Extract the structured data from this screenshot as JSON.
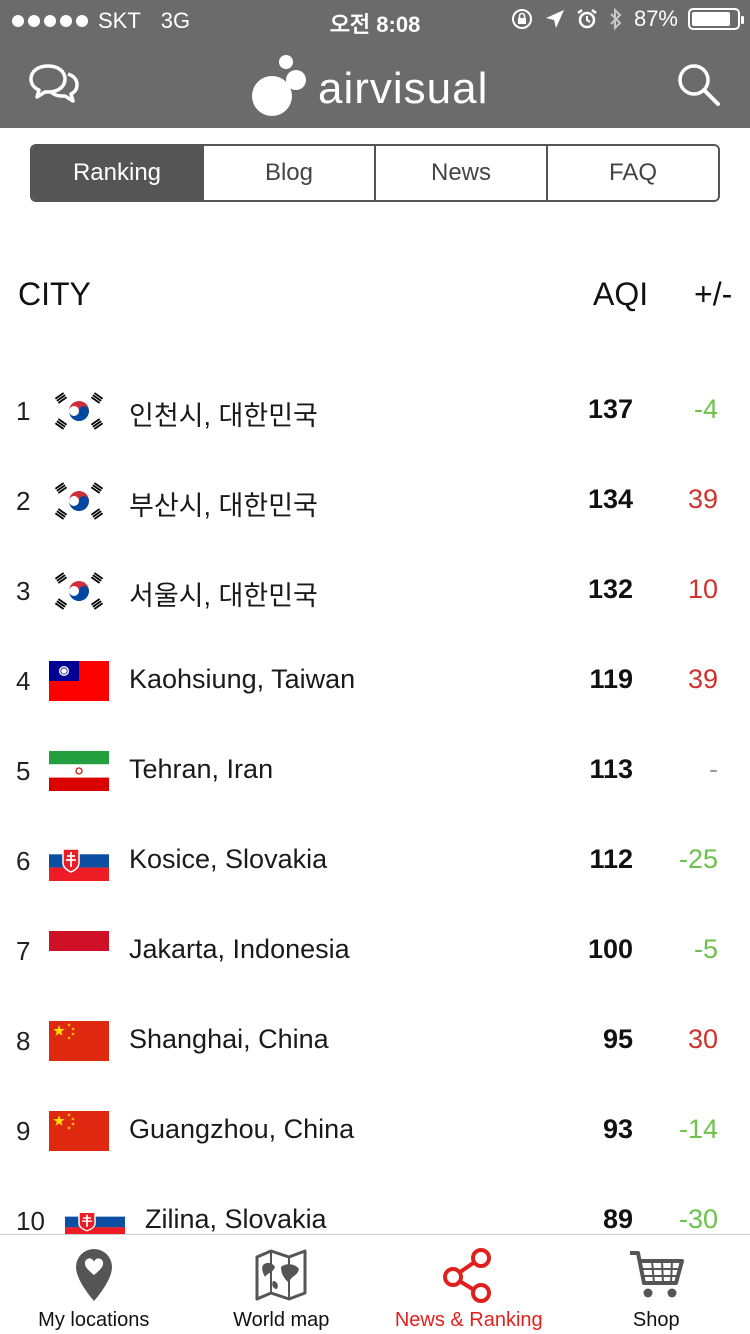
{
  "status_bar": {
    "carrier": "SKT",
    "network": "3G",
    "time": "오전 8:08",
    "battery": "87%"
  },
  "app": {
    "name": "airvisual"
  },
  "tabs": [
    {
      "label": "Ranking",
      "active": true
    },
    {
      "label": "Blog",
      "active": false
    },
    {
      "label": "News",
      "active": false
    },
    {
      "label": "FAQ",
      "active": false
    }
  ],
  "table": {
    "headers": {
      "city": "CITY",
      "aqi": "AQI",
      "change": "+/-"
    },
    "rows": [
      {
        "rank": "1",
        "flag": "kr",
        "city": "인천시, 대한민국",
        "aqi": "137",
        "change": "-4",
        "trend": "down"
      },
      {
        "rank": "2",
        "flag": "kr",
        "city": "부산시, 대한민국",
        "aqi": "134",
        "change": "39",
        "trend": "up"
      },
      {
        "rank": "3",
        "flag": "kr",
        "city": "서울시, 대한민국",
        "aqi": "132",
        "change": "10",
        "trend": "up"
      },
      {
        "rank": "4",
        "flag": "tw",
        "city": "Kaohsiung, Taiwan",
        "aqi": "119",
        "change": "39",
        "trend": "up"
      },
      {
        "rank": "5",
        "flag": "ir",
        "city": "Tehran, Iran",
        "aqi": "113",
        "change": "-",
        "trend": "none"
      },
      {
        "rank": "6",
        "flag": "sk",
        "city": "Kosice, Slovakia",
        "aqi": "112",
        "change": "-25",
        "trend": "down"
      },
      {
        "rank": "7",
        "flag": "id",
        "city": "Jakarta, Indonesia",
        "aqi": "100",
        "change": "-5",
        "trend": "down"
      },
      {
        "rank": "8",
        "flag": "cn",
        "city": "Shanghai, China",
        "aqi": "95",
        "change": "30",
        "trend": "up"
      },
      {
        "rank": "9",
        "flag": "cn",
        "city": "Guangzhou, China",
        "aqi": "93",
        "change": "-14",
        "trend": "down"
      },
      {
        "rank": "10",
        "flag": "sk",
        "city": "Zilina, Slovakia",
        "aqi": "89",
        "change": "-30",
        "trend": "down"
      }
    ]
  },
  "bottom_nav": [
    {
      "label": "My locations",
      "icon": "map-pin-heart-icon",
      "active": false
    },
    {
      "label": "World map",
      "icon": "world-map-icon",
      "active": false
    },
    {
      "label": "News & Ranking",
      "icon": "share-network-icon",
      "active": true
    },
    {
      "label": "Shop",
      "icon": "shopping-cart-icon",
      "active": false
    }
  ],
  "colors": {
    "header_bg": "#6b6b6b",
    "tab_active_bg": "#555555",
    "change_up": "#d0312d",
    "change_down": "#6cc24a",
    "change_none": "#9a9a9a",
    "nav_active": "#e0201c"
  }
}
